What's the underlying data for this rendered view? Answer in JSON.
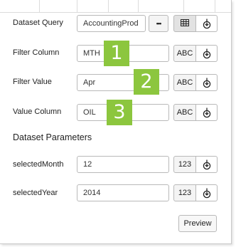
{
  "dataset_query": {
    "label": "Dataset Query",
    "value": "AccountingProd",
    "more_label": "•••",
    "table_icon": "table-icon",
    "bind_icon": "data-bind-icon"
  },
  "filter_column": {
    "label": "Filter Column",
    "value": "MTH",
    "type_label": "ABC",
    "badge": "1"
  },
  "filter_value": {
    "label": "Filter Value",
    "value": "Apr",
    "type_label": "ABC",
    "badge": "2"
  },
  "value_column": {
    "label": "Value Column",
    "value": "OIL",
    "type_label": "ABC",
    "badge": "3"
  },
  "parameters": {
    "heading": "Dataset Parameters",
    "items": [
      {
        "label": "selectedMonth",
        "value": "12",
        "type_label": "123"
      },
      {
        "label": "selectedYear",
        "value": "2014",
        "type_label": "123"
      }
    ]
  },
  "preview_label": "Preview",
  "colors": {
    "badge": "#8cc63e",
    "border": "#b9b9b9"
  }
}
